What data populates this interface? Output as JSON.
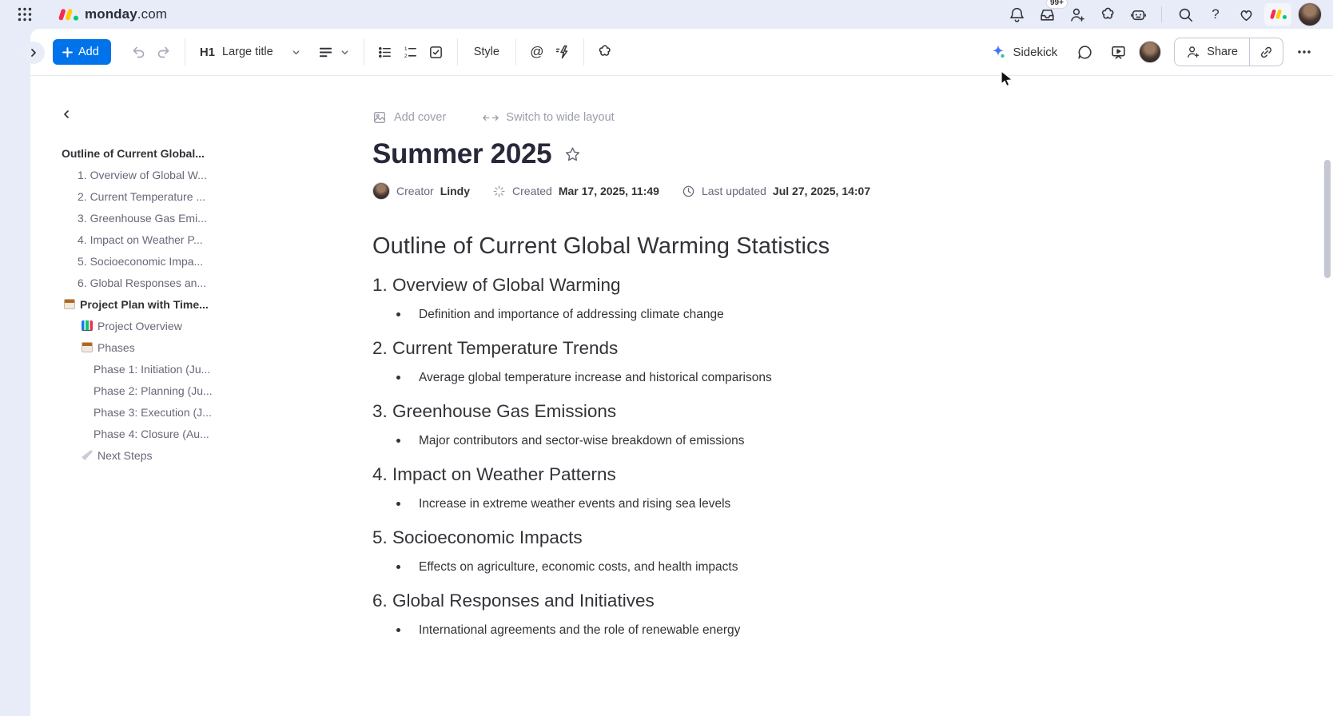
{
  "colors": {
    "accent": "#0073ea",
    "brand_red": "#f62b54",
    "brand_yellow": "#ffcb00",
    "brand_green": "#00ca72",
    "topbar_bg": "#e7ecf8",
    "text_dark": "#323338",
    "text_gray": "#676879"
  },
  "topbar": {
    "logo_bold": "monday",
    "logo_light": ".com",
    "inbox_badge": "99+",
    "help_glyph": "?",
    "icons": [
      "apps-grid",
      "notifications-bell",
      "inbox-updates",
      "invite-member",
      "marketplace-blob",
      "assistant-bot",
      "search",
      "help",
      "favorites-heart",
      "monday-mark",
      "user-avatar"
    ]
  },
  "toolbar": {
    "add_label": "Add",
    "heading_tag": "H1",
    "heading_label": "Large title",
    "style_label": "Style",
    "at_glyph": "@",
    "sidekick_label": "Sidekick",
    "share_label": "Share",
    "icons": [
      "expand-panel",
      "undo",
      "redo",
      "text-align",
      "bullet-list",
      "numbered-list",
      "checklist",
      "mention",
      "ai-writer",
      "apps-blob",
      "sidekick-sparkle",
      "comments-bubble",
      "present-mode",
      "share-invite",
      "copy-link",
      "more-options"
    ]
  },
  "sidebar": {
    "items": [
      {
        "label": "Outline of Current Global...",
        "indent": 0,
        "bold": true
      },
      {
        "label": "1. Overview of Global W...",
        "indent": 1
      },
      {
        "label": "2. Current Temperature ...",
        "indent": 1
      },
      {
        "label": "3. Greenhouse Gas Emi...",
        "indent": 1
      },
      {
        "label": "4. Impact on Weather P...",
        "indent": 1
      },
      {
        "label": "5. Socioeconomic Impa...",
        "indent": 1
      },
      {
        "label": "6. Global Responses an...",
        "indent": 1
      },
      {
        "label": "Project Plan with Time...",
        "indent": 1,
        "bold": true,
        "icon": "calendar"
      },
      {
        "label": "Project Overview",
        "indent": 2,
        "icon": "chart"
      },
      {
        "label": "Phases",
        "indent": 2,
        "icon": "calendar"
      },
      {
        "label": "Phase 1: Initiation (Ju...",
        "indent": 2
      },
      {
        "label": "Phase 2: Planning (Ju...",
        "indent": 2
      },
      {
        "label": "Phase 3: Execution (J...",
        "indent": 2
      },
      {
        "label": "Phase 4: Closure (Au...",
        "indent": 2
      },
      {
        "label": "Next Steps",
        "indent": 2,
        "icon": "rocket"
      }
    ]
  },
  "doc": {
    "add_cover_label": "Add cover",
    "wide_layout_label": "Switch to wide layout",
    "title": "Summer 2025",
    "meta": {
      "creator_label": "Creator",
      "creator_name": "Lindy",
      "created_label": "Created",
      "created_value": "Mar 17, 2025, 11:49",
      "updated_label": "Last updated",
      "updated_value": "Jul 27, 2025, 14:07"
    },
    "heading": "Outline of Current Global Warming Statistics",
    "sections": [
      {
        "title": "1. Overview of Global Warming",
        "bullet": "Definition and importance of addressing climate change"
      },
      {
        "title": "2. Current Temperature Trends",
        "bullet": "Average global temperature increase and historical comparisons"
      },
      {
        "title": "3. Greenhouse Gas Emissions",
        "bullet": "Major contributors and sector-wise breakdown of emissions"
      },
      {
        "title": "4. Impact on Weather Patterns",
        "bullet": "Increase in extreme weather events and rising sea levels"
      },
      {
        "title": "5. Socioeconomic Impacts",
        "bullet": "Effects on agriculture, economic costs, and health impacts"
      },
      {
        "title": "6. Global Responses and Initiatives",
        "bullet": "International agreements and the role of renewable energy"
      }
    ]
  }
}
